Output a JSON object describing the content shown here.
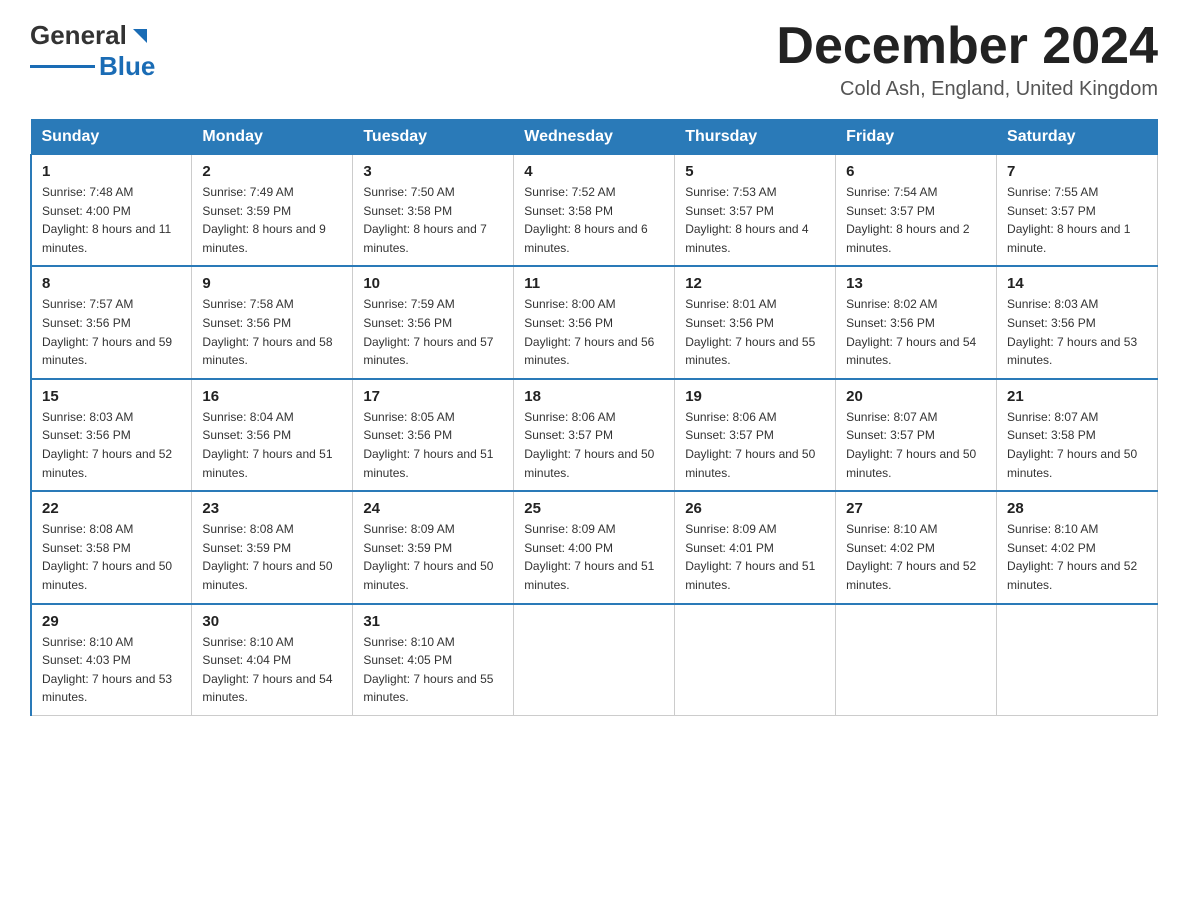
{
  "header": {
    "logo_general": "General",
    "logo_blue": "Blue",
    "month_title": "December 2024",
    "location": "Cold Ash, England, United Kingdom"
  },
  "days_of_week": [
    "Sunday",
    "Monday",
    "Tuesday",
    "Wednesday",
    "Thursday",
    "Friday",
    "Saturday"
  ],
  "weeks": [
    [
      {
        "day": "1",
        "sunrise": "7:48 AM",
        "sunset": "4:00 PM",
        "daylight": "8 hours and 11 minutes."
      },
      {
        "day": "2",
        "sunrise": "7:49 AM",
        "sunset": "3:59 PM",
        "daylight": "8 hours and 9 minutes."
      },
      {
        "day": "3",
        "sunrise": "7:50 AM",
        "sunset": "3:58 PM",
        "daylight": "8 hours and 7 minutes."
      },
      {
        "day": "4",
        "sunrise": "7:52 AM",
        "sunset": "3:58 PM",
        "daylight": "8 hours and 6 minutes."
      },
      {
        "day": "5",
        "sunrise": "7:53 AM",
        "sunset": "3:57 PM",
        "daylight": "8 hours and 4 minutes."
      },
      {
        "day": "6",
        "sunrise": "7:54 AM",
        "sunset": "3:57 PM",
        "daylight": "8 hours and 2 minutes."
      },
      {
        "day": "7",
        "sunrise": "7:55 AM",
        "sunset": "3:57 PM",
        "daylight": "8 hours and 1 minute."
      }
    ],
    [
      {
        "day": "8",
        "sunrise": "7:57 AM",
        "sunset": "3:56 PM",
        "daylight": "7 hours and 59 minutes."
      },
      {
        "day": "9",
        "sunrise": "7:58 AM",
        "sunset": "3:56 PM",
        "daylight": "7 hours and 58 minutes."
      },
      {
        "day": "10",
        "sunrise": "7:59 AM",
        "sunset": "3:56 PM",
        "daylight": "7 hours and 57 minutes."
      },
      {
        "day": "11",
        "sunrise": "8:00 AM",
        "sunset": "3:56 PM",
        "daylight": "7 hours and 56 minutes."
      },
      {
        "day": "12",
        "sunrise": "8:01 AM",
        "sunset": "3:56 PM",
        "daylight": "7 hours and 55 minutes."
      },
      {
        "day": "13",
        "sunrise": "8:02 AM",
        "sunset": "3:56 PM",
        "daylight": "7 hours and 54 minutes."
      },
      {
        "day": "14",
        "sunrise": "8:03 AM",
        "sunset": "3:56 PM",
        "daylight": "7 hours and 53 minutes."
      }
    ],
    [
      {
        "day": "15",
        "sunrise": "8:03 AM",
        "sunset": "3:56 PM",
        "daylight": "7 hours and 52 minutes."
      },
      {
        "day": "16",
        "sunrise": "8:04 AM",
        "sunset": "3:56 PM",
        "daylight": "7 hours and 51 minutes."
      },
      {
        "day": "17",
        "sunrise": "8:05 AM",
        "sunset": "3:56 PM",
        "daylight": "7 hours and 51 minutes."
      },
      {
        "day": "18",
        "sunrise": "8:06 AM",
        "sunset": "3:57 PM",
        "daylight": "7 hours and 50 minutes."
      },
      {
        "day": "19",
        "sunrise": "8:06 AM",
        "sunset": "3:57 PM",
        "daylight": "7 hours and 50 minutes."
      },
      {
        "day": "20",
        "sunrise": "8:07 AM",
        "sunset": "3:57 PM",
        "daylight": "7 hours and 50 minutes."
      },
      {
        "day": "21",
        "sunrise": "8:07 AM",
        "sunset": "3:58 PM",
        "daylight": "7 hours and 50 minutes."
      }
    ],
    [
      {
        "day": "22",
        "sunrise": "8:08 AM",
        "sunset": "3:58 PM",
        "daylight": "7 hours and 50 minutes."
      },
      {
        "day": "23",
        "sunrise": "8:08 AM",
        "sunset": "3:59 PM",
        "daylight": "7 hours and 50 minutes."
      },
      {
        "day": "24",
        "sunrise": "8:09 AM",
        "sunset": "3:59 PM",
        "daylight": "7 hours and 50 minutes."
      },
      {
        "day": "25",
        "sunrise": "8:09 AM",
        "sunset": "4:00 PM",
        "daylight": "7 hours and 51 minutes."
      },
      {
        "day": "26",
        "sunrise": "8:09 AM",
        "sunset": "4:01 PM",
        "daylight": "7 hours and 51 minutes."
      },
      {
        "day": "27",
        "sunrise": "8:10 AM",
        "sunset": "4:02 PM",
        "daylight": "7 hours and 52 minutes."
      },
      {
        "day": "28",
        "sunrise": "8:10 AM",
        "sunset": "4:02 PM",
        "daylight": "7 hours and 52 minutes."
      }
    ],
    [
      {
        "day": "29",
        "sunrise": "8:10 AM",
        "sunset": "4:03 PM",
        "daylight": "7 hours and 53 minutes."
      },
      {
        "day": "30",
        "sunrise": "8:10 AM",
        "sunset": "4:04 PM",
        "daylight": "7 hours and 54 minutes."
      },
      {
        "day": "31",
        "sunrise": "8:10 AM",
        "sunset": "4:05 PM",
        "daylight": "7 hours and 55 minutes."
      },
      null,
      null,
      null,
      null
    ]
  ],
  "labels": {
    "sunrise": "Sunrise:",
    "sunset": "Sunset:",
    "daylight": "Daylight:"
  }
}
